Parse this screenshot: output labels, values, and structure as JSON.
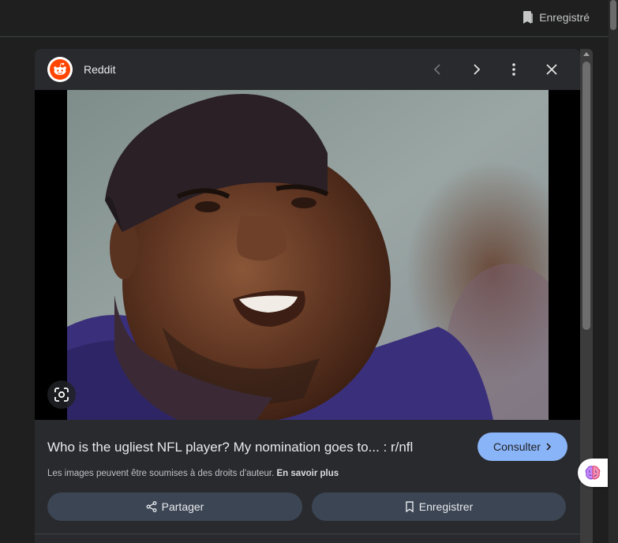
{
  "topbar": {
    "saved_label": "Enregistré",
    "saved_icon": "bookmark-icon"
  },
  "panel": {
    "source_name": "Reddit",
    "source_icon": "reddit-logo",
    "nav": {
      "prev_icon": "chevron-left-icon",
      "next_icon": "chevron-right-icon",
      "more_icon": "more-vert-icon",
      "close_icon": "close-icon"
    },
    "image": {
      "lens_icon": "google-lens-icon"
    },
    "title": "Who is the ugliest NFL player? My nomination goes to... : r/nfl",
    "visit_label": "Consulter",
    "copyright_text": "Les images peuvent être soumises à des droits d'auteur.",
    "learn_more": "En savoir plus",
    "share_label": "Partager",
    "save_label": "Enregistrer"
  },
  "extension": {
    "icon": "brain-icon"
  },
  "colors": {
    "accent": "#8ab4f8",
    "panel_bg": "#292a2d",
    "page_bg": "#1f1f1f",
    "pill_bg": "#3c4554",
    "reddit": "#ff4500"
  }
}
